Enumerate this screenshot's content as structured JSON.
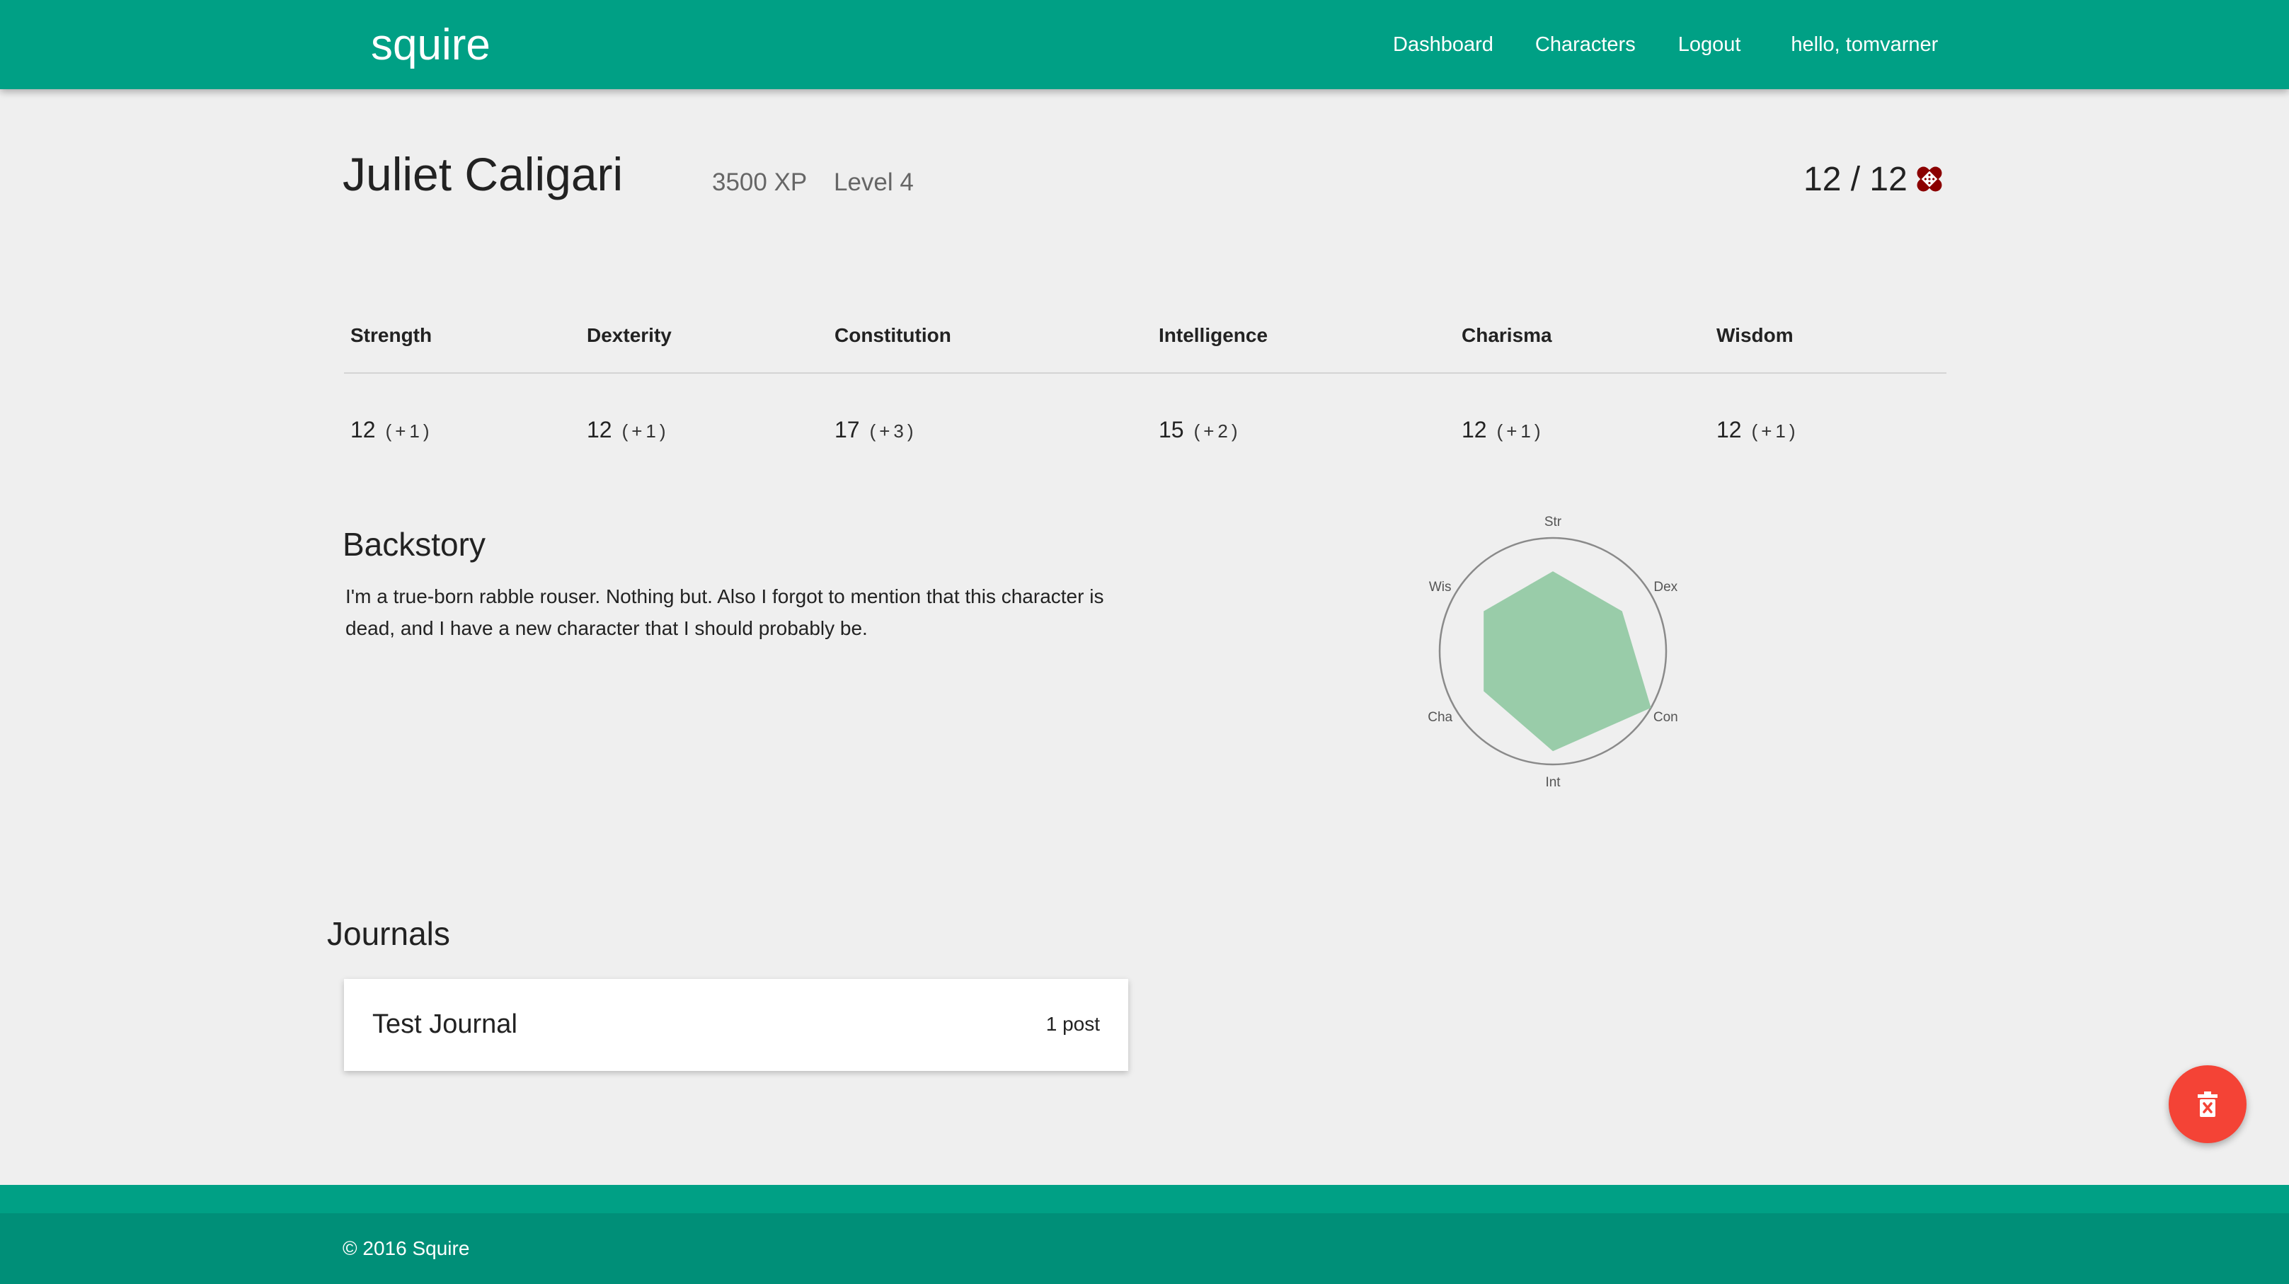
{
  "navbar": {
    "brand": "squire",
    "links": [
      "Dashboard",
      "Characters",
      "Logout"
    ],
    "greeting": "hello, tomvarner"
  },
  "character": {
    "name": "Juliet Caligari",
    "xp": "3500 XP",
    "level": "Level 4",
    "hp": "12 / 12",
    "hp_icon": "bandage-icon",
    "hp_icon_color": "#8b0000"
  },
  "abilities": [
    {
      "name": "Strength",
      "score": "12",
      "modifier": "(+1)"
    },
    {
      "name": "Dexterity",
      "score": "12",
      "modifier": "(+1)"
    },
    {
      "name": "Constitution",
      "score": "17",
      "modifier": "(+3)"
    },
    {
      "name": "Intelligence",
      "score": "15",
      "modifier": "(+2)"
    },
    {
      "name": "Charisma",
      "score": "12",
      "modifier": "(+1)"
    },
    {
      "name": "Wisdom",
      "score": "12",
      "modifier": "(+1)"
    }
  ],
  "backstory": {
    "title": "Backstory",
    "text": "I'm a true-born rabble rouser. Nothing but. Also I forgot to mention that this character is dead, and I have a new character that I should probably be."
  },
  "radar": {
    "labels": [
      "Str",
      "Dex",
      "Con",
      "Int",
      "Cha",
      "Wis"
    ],
    "values": [
      12,
      12,
      17,
      15,
      12,
      12
    ],
    "max": 17,
    "fill_color": "#99cca9"
  },
  "journals": {
    "title": "Journals",
    "items": [
      {
        "name": "Test Journal",
        "count": "1 post"
      }
    ]
  },
  "fab": {
    "icon": "trash-icon",
    "color": "#f44336"
  },
  "footer": {
    "text": "© 2016 Squire"
  },
  "colors": {
    "primary": "#00a085",
    "footer": "#008f78",
    "background": "#efefef"
  }
}
